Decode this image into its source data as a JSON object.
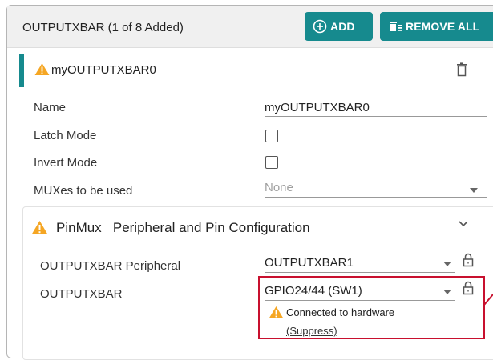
{
  "header": {
    "title": "OUTPUTXBAR (1 of 8 Added)",
    "add_label": "ADD",
    "remove_all_label": "REMOVE ALL"
  },
  "instance": {
    "name": "myOUTPUTXBAR0"
  },
  "fields": {
    "name_label": "Name",
    "name_value": "myOUTPUTXBAR0",
    "latch_label": "Latch Mode",
    "latch_checked": false,
    "invert_label": "Invert Mode",
    "invert_checked": false,
    "muxes_label": "MUXes to be used",
    "muxes_value": "None"
  },
  "pinmux": {
    "title": "PinMux   Peripheral and Pin Configuration",
    "peripheral_label": "OUTPUTXBAR Peripheral",
    "peripheral_value": "OUTPUTXBAR1",
    "pin_label": "OUTPUTXBAR",
    "pin_value": "GPIO24/44 (SW1)",
    "warning_text": "Connected to hardware",
    "suppress_label": "(Suppress)"
  },
  "colors": {
    "accent": "#168a8e",
    "warning": "#f5a623",
    "highlight": "#c8102e"
  },
  "icons": [
    "add-circle-icon",
    "remove-all-icon",
    "warning-icon",
    "trash-icon",
    "chevron-down-icon",
    "lock-icon",
    "dropdown-caret-icon"
  ]
}
